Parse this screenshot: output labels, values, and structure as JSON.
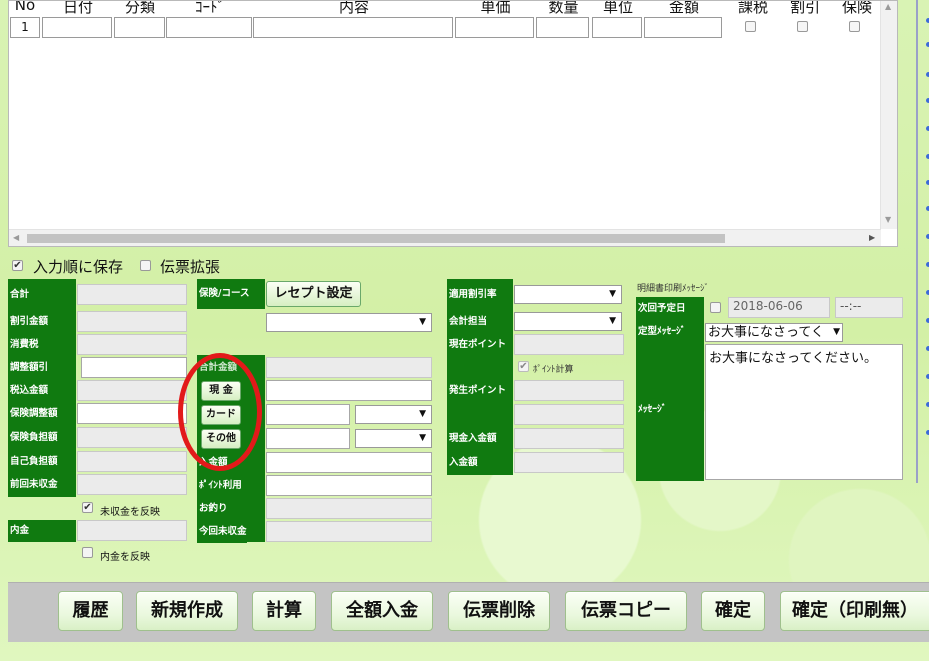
{
  "table": {
    "headers": [
      "No",
      "日付",
      "分類",
      "ｺｰﾄﾞ",
      "内容",
      "単価",
      "数量",
      "単位",
      "金額",
      "課税",
      "割引",
      "保険"
    ],
    "row1_no": "1"
  },
  "options": {
    "save_in_order_label": "入力順に保存",
    "save_in_order_checked": true,
    "slip_expand_label": "伝票拡張",
    "slip_expand_checked": false
  },
  "left_panel": {
    "total": "合計",
    "discount_amount": "割引金額",
    "consumption_tax": "消費税",
    "adjust_discount": "調整額引",
    "tax_included": "税込金額",
    "insurance_adjust": "保険調整額",
    "insurance_burden": "保険負担額",
    "self_burden": "自己負担額",
    "previous_unpaid": "前回未収金",
    "reflect_unpaid_label": "未収金を反映",
    "reflect_unpaid_checked": true,
    "internal_payment": "内金",
    "reflect_internal_label": "内金を反映",
    "reflect_internal_checked": false
  },
  "middle_panel": {
    "insurance_course": "保険/コース",
    "receipt_setting_button": "レセプト設定",
    "total_amount_partial": "合計金額",
    "cash_button": "現 金",
    "card_button": "カード",
    "other_button": "その他",
    "deposit_partial": "入金額",
    "point_use": "ﾎﾟｲﾝﾄ利用",
    "change": "お釣り",
    "current_unpaid": "今回未収金"
  },
  "right_panel": {
    "applied_discount_rate": "適用割引率",
    "accounting_staff": "会計担当",
    "current_points": "現在ポイント",
    "point_calc_label": "ﾎﾟｲﾝﾄ計算",
    "point_calc_checked": true,
    "earned_points": "発生ポイント",
    "cash_deposit": "現金入金額",
    "deposit": "入金額"
  },
  "message_panel": {
    "header": "明細書印刷ﾒｯｾｰｼﾞ",
    "next_visit_label": "次回予定日",
    "next_visit_date": "2018-06-06",
    "next_visit_time": "--:--",
    "template_label": "定型ﾒｯｾｰｼﾞ",
    "template_value": "お大事になさってく",
    "message_label": "ﾒｯｾｰｼﾞ",
    "message_text": "お大事になさってください。"
  },
  "buttons": {
    "history": "履歴",
    "new": "新規作成",
    "calculate": "計算",
    "full_payment": "全額入金",
    "delete_slip": "伝票削除",
    "copy_slip": "伝票コピー",
    "confirm": "確定",
    "confirm_no_print": "確定（印刷無）"
  },
  "icons": [
    "checkbox-icon",
    "dropdown-caret-icon",
    "scroll-arrow-icon"
  ],
  "colors": {
    "label_green": "#107a10",
    "background_green": "#d6f2ad",
    "highlight_red": "#e21a1a"
  }
}
